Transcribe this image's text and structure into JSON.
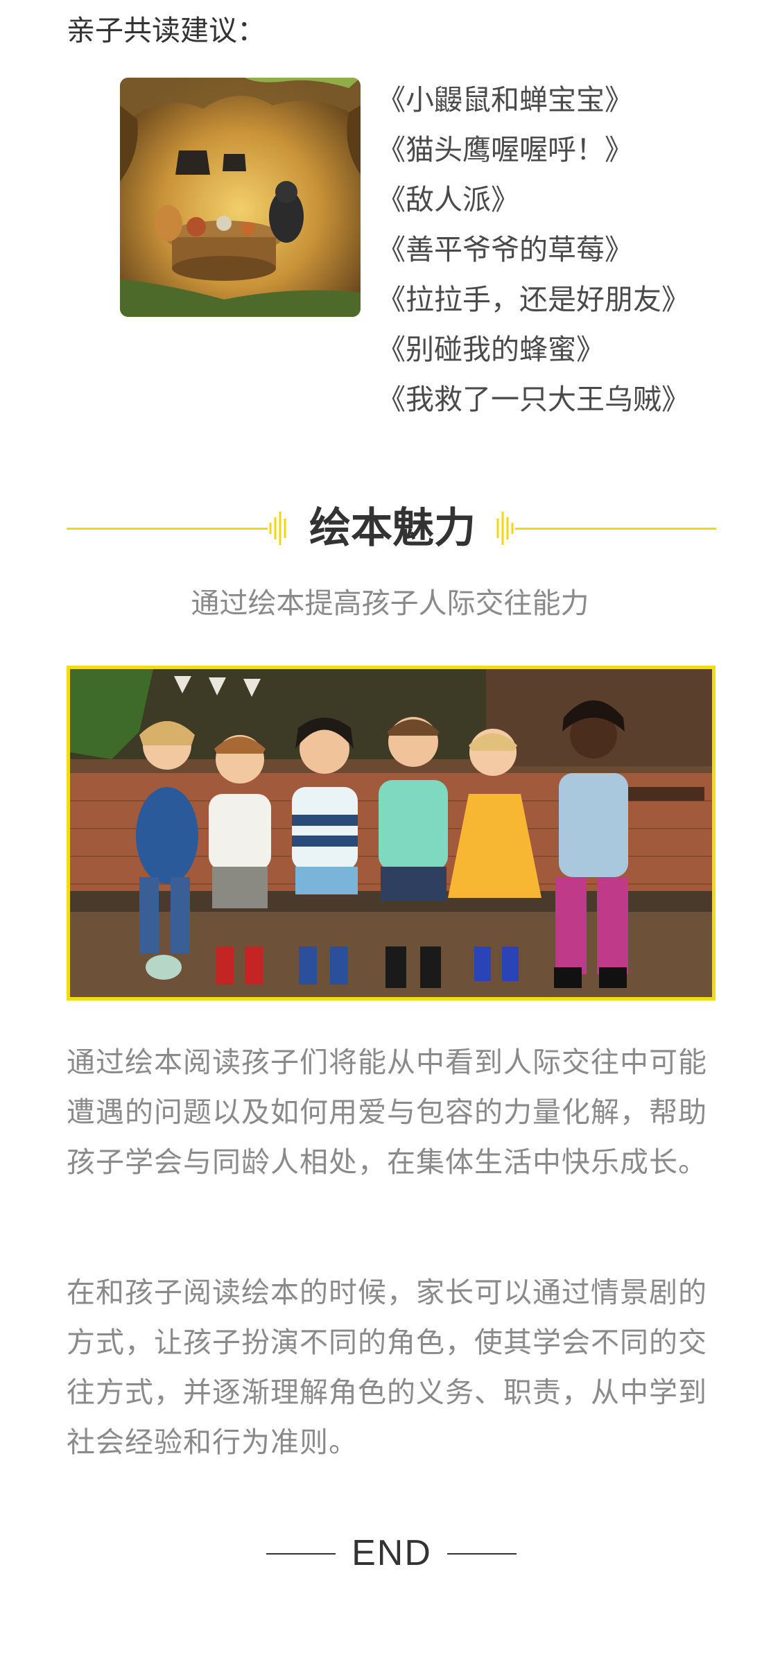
{
  "suggestion": {
    "heading": "亲子共读建议：",
    "books": [
      "《小鼹鼠和蝉宝宝》",
      "《猫头鹰喔喔呼！》",
      "《敌人派》",
      "《善平爷爷的草莓》",
      "《拉拉手，还是好朋友》",
      "《别碰我的蜂蜜》",
      "《我救了一只大王乌贼》"
    ]
  },
  "section": {
    "title": "绘本魅力",
    "subtitle": "通过绘本提高孩子人际交往能力",
    "accent_color": "#f4dc14"
  },
  "body": {
    "paragraph1": "通过绘本阅读孩子们将能从中看到人际交往中可能遭遇的问题以及如何用爱与包容的力量化解，帮助孩子学会与同龄人相处，在集体生活中快乐成长。",
    "paragraph2": "在和孩子阅读绘本的时候，家长可以通过情景剧的方式，让孩子扮演不同的角色，使其学会不同的交往方式，并逐渐理解角色的义务、职责，从中学到社会经验和行为准则。"
  },
  "footer": {
    "end_label": "END"
  }
}
